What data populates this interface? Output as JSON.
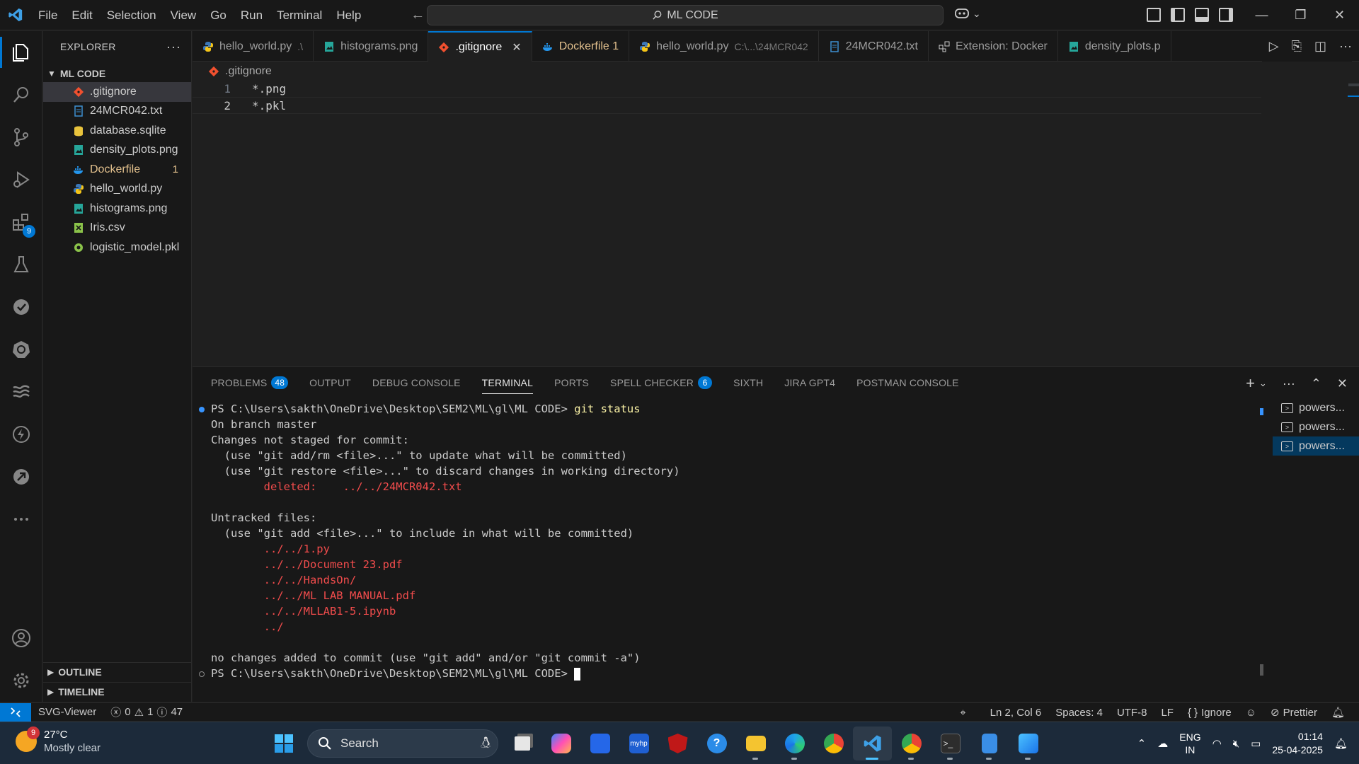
{
  "titlebar": {
    "menu": [
      "File",
      "Edit",
      "Selection",
      "View",
      "Go",
      "Run",
      "Terminal",
      "Help"
    ],
    "search_text": "ML CODE"
  },
  "activity": {
    "extensions_badge": "9"
  },
  "sidebar": {
    "title": "EXPLORER",
    "folder": "ML CODE",
    "files": [
      {
        "name": ".gitignore",
        "icon": "git-icon",
        "color": "#f1502f",
        "selected": true,
        "badge": ""
      },
      {
        "name": "24MCR042.txt",
        "icon": "text-file-icon",
        "color": "#3d8fd1",
        "selected": false,
        "badge": ""
      },
      {
        "name": "database.sqlite",
        "icon": "database-icon",
        "color": "#e8c33c",
        "selected": false,
        "badge": ""
      },
      {
        "name": "density_plots.png",
        "icon": "image-icon",
        "color": "#26a69a",
        "selected": false,
        "badge": ""
      },
      {
        "name": "Dockerfile",
        "icon": "docker-icon",
        "color": "#2496ed",
        "selected": false,
        "badge": "1",
        "warn": true
      },
      {
        "name": "hello_world.py",
        "icon": "python-icon",
        "color": "#3b77b8",
        "selected": false,
        "badge": ""
      },
      {
        "name": "histograms.png",
        "icon": "image-icon",
        "color": "#26a69a",
        "selected": false,
        "badge": ""
      },
      {
        "name": "Iris.csv",
        "icon": "csv-icon",
        "color": "#8bc34a",
        "selected": false,
        "badge": ""
      },
      {
        "name": "logistic_model.pkl",
        "icon": "gear-file-icon",
        "color": "#8bc34a",
        "selected": false,
        "badge": ""
      }
    ],
    "outline": "OUTLINE",
    "timeline": "TIMELINE"
  },
  "tabs": [
    {
      "label": "hello_world.py",
      "desc": ".\\",
      "icon": "python-icon",
      "active": false
    },
    {
      "label": "histograms.png",
      "desc": "",
      "icon": "image-icon",
      "active": false
    },
    {
      "label": ".gitignore",
      "desc": "",
      "icon": "git-icon",
      "active": true
    },
    {
      "label": "Dockerfile 1",
      "desc": "",
      "icon": "docker-icon",
      "active": false,
      "warn": true
    },
    {
      "label": "hello_world.py",
      "desc": "C:\\...\\24MCR042",
      "icon": "python-icon",
      "active": false
    },
    {
      "label": "24MCR042.txt",
      "desc": "",
      "icon": "text-file-icon",
      "active": false
    },
    {
      "label": "Extension: Docker",
      "desc": "",
      "icon": "extension-icon",
      "active": false
    },
    {
      "label": "density_plots.p",
      "desc": "",
      "icon": "image-icon",
      "active": false
    }
  ],
  "editor": {
    "breadcrumb": ".gitignore",
    "lines": [
      {
        "num": "1",
        "text": "*.png"
      },
      {
        "num": "2",
        "text": "*.pkl"
      }
    ]
  },
  "panel": {
    "tabs": [
      {
        "label": "PROBLEMS",
        "badge": "48"
      },
      {
        "label": "OUTPUT",
        "badge": ""
      },
      {
        "label": "DEBUG CONSOLE",
        "badge": ""
      },
      {
        "label": "TERMINAL",
        "badge": "",
        "active": true
      },
      {
        "label": "PORTS",
        "badge": ""
      },
      {
        "label": "SPELL CHECKER",
        "badge": "6"
      },
      {
        "label": "SIXTH",
        "badge": ""
      },
      {
        "label": "JIRA GPT4",
        "badge": ""
      },
      {
        "label": "POSTMAN CONSOLE",
        "badge": ""
      }
    ],
    "terminal": {
      "prompt": "PS C:\\Users\\sakth\\OneDrive\\Desktop\\SEM2\\ML\\gl\\ML CODE> ",
      "command": "git status",
      "lines": [
        {
          "text": "On branch master",
          "red": false
        },
        {
          "text": "Changes not staged for commit:",
          "red": false
        },
        {
          "text": "  (use \"git add/rm <file>...\" to update what will be committed)",
          "red": false
        },
        {
          "text": "  (use \"git restore <file>...\" to discard changes in working directory)",
          "red": false
        },
        {
          "text": "        deleted:    ../../24MCR042.txt",
          "red": true
        },
        {
          "text": "",
          "red": false
        },
        {
          "text": "Untracked files:",
          "red": false
        },
        {
          "text": "  (use \"git add <file>...\" to include in what will be committed)",
          "red": false
        },
        {
          "text": "        ../../1.py",
          "red": true
        },
        {
          "text": "        ../../Document 23.pdf",
          "red": true
        },
        {
          "text": "        ../../HandsOn/",
          "red": true
        },
        {
          "text": "        ../../ML LAB MANUAL.pdf",
          "red": true
        },
        {
          "text": "        ../../MLLAB1-5.ipynb",
          "red": true
        },
        {
          "text": "        ../",
          "red": true
        },
        {
          "text": "",
          "red": false
        },
        {
          "text": "no changes added to commit (use \"git add\" and/or \"git commit -a\")",
          "red": false
        }
      ],
      "final_prompt": "PS C:\\Users\\sakth\\OneDrive\\Desktop\\SEM2\\ML\\gl\\ML CODE> "
    },
    "terminal_list": [
      "powers...",
      "powers...",
      "powers..."
    ]
  },
  "statusbar": {
    "svg_viewer": "SVG-Viewer",
    "errors": "0",
    "warnings": "1",
    "infos": "47",
    "position": "Ln 2, Col 6",
    "spaces": "Spaces: 4",
    "encoding": "UTF-8",
    "eol": "LF",
    "language": "Ignore",
    "prettier": "Prettier"
  },
  "taskbar": {
    "weather_badge": "9",
    "temperature": "27°C",
    "condition": "Mostly clear",
    "search_label": "Search",
    "lang_top": "ENG",
    "lang_bottom": "IN",
    "time": "01:14",
    "date": "25-04-2025"
  }
}
